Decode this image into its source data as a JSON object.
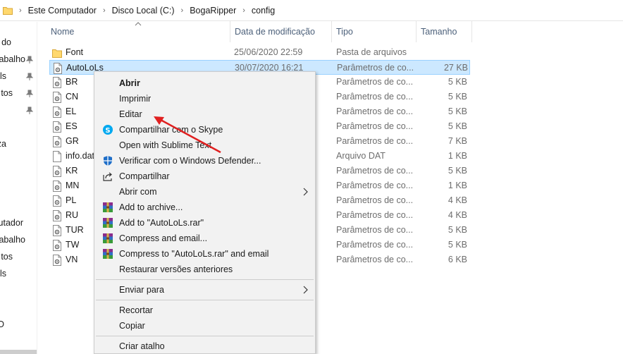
{
  "breadcrumb": [
    "Este Computador",
    "Disco Local (C:)",
    "BogaRipper",
    "config"
  ],
  "nav": {
    "items": [
      {
        "label": "do",
        "pinned": false
      },
      {
        "label": "abalho",
        "pinned": true
      },
      {
        "label": "ls",
        "pinned": true
      },
      {
        "label": "tos",
        "pinned": true
      },
      {
        "label": "",
        "pinned": true
      },
      {
        "label": "za",
        "pinned": false
      },
      {
        "label": "utador",
        "pinned": false
      },
      {
        "label": "abalho",
        "pinned": false
      },
      {
        "label": "tos",
        "pinned": false
      },
      {
        "label": "ls",
        "pinned": false
      },
      {
        "label": "D",
        "pinned": false
      }
    ]
  },
  "columns": {
    "name": "Nome",
    "date": "Data de modificação",
    "type": "Tipo",
    "size": "Tamanho"
  },
  "files": [
    {
      "name": "Font",
      "date": "25/06/2020 22:59",
      "type": "Pasta de arquivos",
      "size": "",
      "icon": "folder-icon"
    },
    {
      "name": "AutoLoLs",
      "date": "30/07/2020 16:21",
      "type": "Parâmetros de co...",
      "size": "27 KB",
      "icon": "config-file-icon",
      "selected": true
    },
    {
      "name": "BR",
      "date": "",
      "type": "Parâmetros de co...",
      "size": "5 KB",
      "icon": "config-file-icon"
    },
    {
      "name": "CN",
      "date": "",
      "type": "Parâmetros de co...",
      "size": "5 KB",
      "icon": "config-file-icon"
    },
    {
      "name": "EL",
      "date": "",
      "type": "Parâmetros de co...",
      "size": "5 KB",
      "icon": "config-file-icon"
    },
    {
      "name": "ES",
      "date": "",
      "type": "Parâmetros de co...",
      "size": "5 KB",
      "icon": "config-file-icon"
    },
    {
      "name": "GR",
      "date": "",
      "type": "Parâmetros de co...",
      "size": "7 KB",
      "icon": "config-file-icon"
    },
    {
      "name": "info.dat",
      "date": "",
      "type": "Arquivo DAT",
      "size": "1 KB",
      "icon": "file-icon"
    },
    {
      "name": "KR",
      "date": "",
      "type": "Parâmetros de co...",
      "size": "5 KB",
      "icon": "config-file-icon"
    },
    {
      "name": "MN",
      "date": "",
      "type": "Parâmetros de co...",
      "size": "1 KB",
      "icon": "config-file-icon"
    },
    {
      "name": "PL",
      "date": "",
      "type": "Parâmetros de co...",
      "size": "4 KB",
      "icon": "config-file-icon"
    },
    {
      "name": "RU",
      "date": "",
      "type": "Parâmetros de co...",
      "size": "4 KB",
      "icon": "config-file-icon"
    },
    {
      "name": "TUR",
      "date": "",
      "type": "Parâmetros de co...",
      "size": "5 KB",
      "icon": "config-file-icon"
    },
    {
      "name": "TW",
      "date": "",
      "type": "Parâmetros de co...",
      "size": "5 KB",
      "icon": "config-file-icon"
    },
    {
      "name": "VN",
      "date": "",
      "type": "Parâmetros de co...",
      "size": "6 KB",
      "icon": "config-file-icon"
    }
  ],
  "context_menu": {
    "items": [
      {
        "label": "Abrir",
        "bold": true,
        "icon": "",
        "submenu": false
      },
      {
        "label": "Imprimir",
        "icon": "",
        "submenu": false
      },
      {
        "label": "Editar",
        "icon": "",
        "submenu": false
      },
      {
        "label": "Compartilhar com o Skype",
        "icon": "skype-icon",
        "submenu": false
      },
      {
        "label": "Open with Sublime Text",
        "icon": "",
        "submenu": false
      },
      {
        "label": "Verificar com o Windows Defender...",
        "icon": "defender-shield-icon",
        "submenu": false
      },
      {
        "label": "Compartilhar",
        "icon": "share-icon",
        "submenu": false
      },
      {
        "label": "Abrir com",
        "icon": "",
        "submenu": true
      },
      {
        "label": "Add to archive...",
        "icon": "winrar-icon",
        "submenu": false
      },
      {
        "label": "Add to \"AutoLoLs.rar\"",
        "icon": "winrar-icon",
        "submenu": false
      },
      {
        "label": "Compress and email...",
        "icon": "winrar-icon",
        "submenu": false
      },
      {
        "label": "Compress to \"AutoLoLs.rar\" and email",
        "icon": "winrar-icon",
        "submenu": false
      },
      {
        "label": "Restaurar versões anteriores",
        "icon": "",
        "submenu": false
      },
      {
        "label": "Enviar para",
        "icon": "",
        "submenu": true
      },
      {
        "label": "Recortar",
        "icon": "",
        "submenu": false
      },
      {
        "label": "Copiar",
        "icon": "",
        "submenu": false
      },
      {
        "label": "Criar atalho",
        "icon": "",
        "submenu": false
      }
    ]
  },
  "colors": {
    "selection_bg": "#cce8ff",
    "selection_border": "#99d1ff",
    "header_text": "#4c607a",
    "menu_bg": "#f2f2f2",
    "annotation_arrow": "#e02020"
  }
}
